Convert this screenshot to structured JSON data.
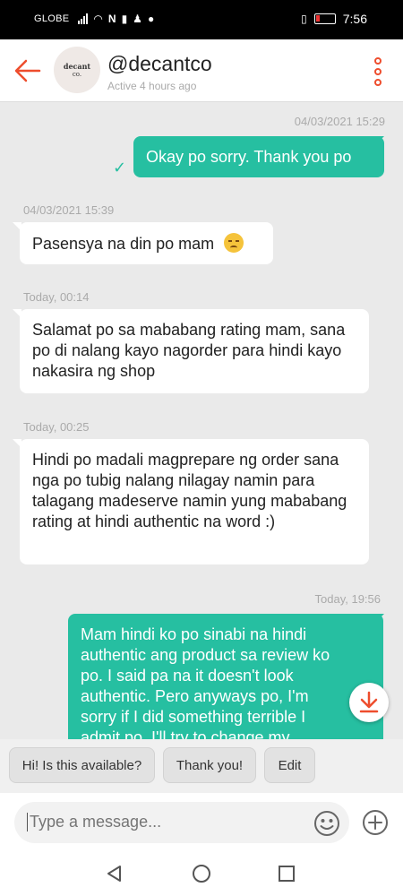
{
  "status_bar": {
    "carrier": "GLOBE",
    "time": "7:56",
    "icons": [
      "signal-icon",
      "wifi-icon",
      "nfc-icon",
      "sim-icon",
      "messenger-icon",
      "vibrate-icon",
      "battery-icon"
    ]
  },
  "header": {
    "shop_name": "@decantco",
    "status": "Active 4 hours ago",
    "avatar_text_1": "decant",
    "avatar_text_2": "co."
  },
  "messages": [
    {
      "direction": "out",
      "timestamp": "04/03/2021 15:29",
      "text": "Okay po sorry. Thank you po",
      "read": true
    },
    {
      "direction": "in",
      "timestamp": "04/03/2021 15:39",
      "text": "Pasensya na din po mam",
      "emoji": "weary-face"
    },
    {
      "direction": "in",
      "timestamp": "Today, 00:14",
      "text": "Salamat po sa mababang rating mam, sana po di nalang kayo nagorder para hindi kayo nakasira ng shop"
    },
    {
      "direction": "in",
      "timestamp": "Today, 00:25",
      "text": "Hindi po madali magprepare ng order sana nga po tubig nalang nilagay namin para talagang madeserve namin yung mababang rating at hindi authentic na word :)"
    },
    {
      "direction": "out",
      "timestamp": "Today, 19:56",
      "text": "Mam hindi ko po sinabi na hindi authentic ang product sa review ko po. I said pa na it doesn't look authentic. Pero anyways po, I'm sorry if I did something terrible I admit po. I'll try to change my"
    }
  ],
  "quick_replies": [
    "Hi! Is this available?",
    "Thank you!",
    "Edit"
  ],
  "input": {
    "placeholder": "Type a message..."
  },
  "colors": {
    "accent": "#ee4d2d",
    "bubble_out": "#26bfa1",
    "background": "#eaeaea"
  }
}
